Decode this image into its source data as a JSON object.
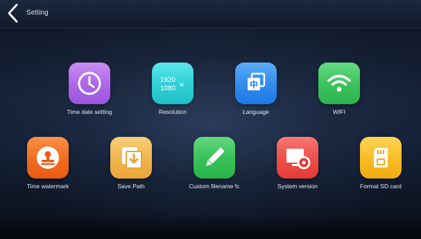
{
  "header": {
    "title": "Setting",
    "back_icon": "chevron-left-icon"
  },
  "settings": {
    "row1": [
      {
        "label": "Time date setting",
        "icon": "clock-icon",
        "color": "#b069e8"
      },
      {
        "label": "Resolution",
        "icon": "resolution-icon",
        "color": "#2fd3d8",
        "icon_text_top": "1920",
        "icon_text_bottom": "1080",
        "icon_text_mark": "×"
      },
      {
        "label": "Language",
        "icon": "language-icon",
        "color": "#2f8ef0",
        "icon_text": "中"
      },
      {
        "label": "WIFI",
        "icon": "wifi-icon",
        "color": "#37c15b"
      }
    ],
    "row2": [
      {
        "label": "Time watermark",
        "icon": "stamp-icon",
        "color": "#f26b1d"
      },
      {
        "label": "Save Path",
        "icon": "save-path-icon",
        "color": "#f0b54a"
      },
      {
        "label": "Custom filename fc",
        "icon": "pencil-icon",
        "color": "#36c257"
      },
      {
        "label": "System version",
        "icon": "system-version-icon",
        "color": "#ef4a45"
      },
      {
        "label": "Format SD card",
        "icon": "sd-card-icon",
        "color": "#f4bd21"
      }
    ]
  }
}
